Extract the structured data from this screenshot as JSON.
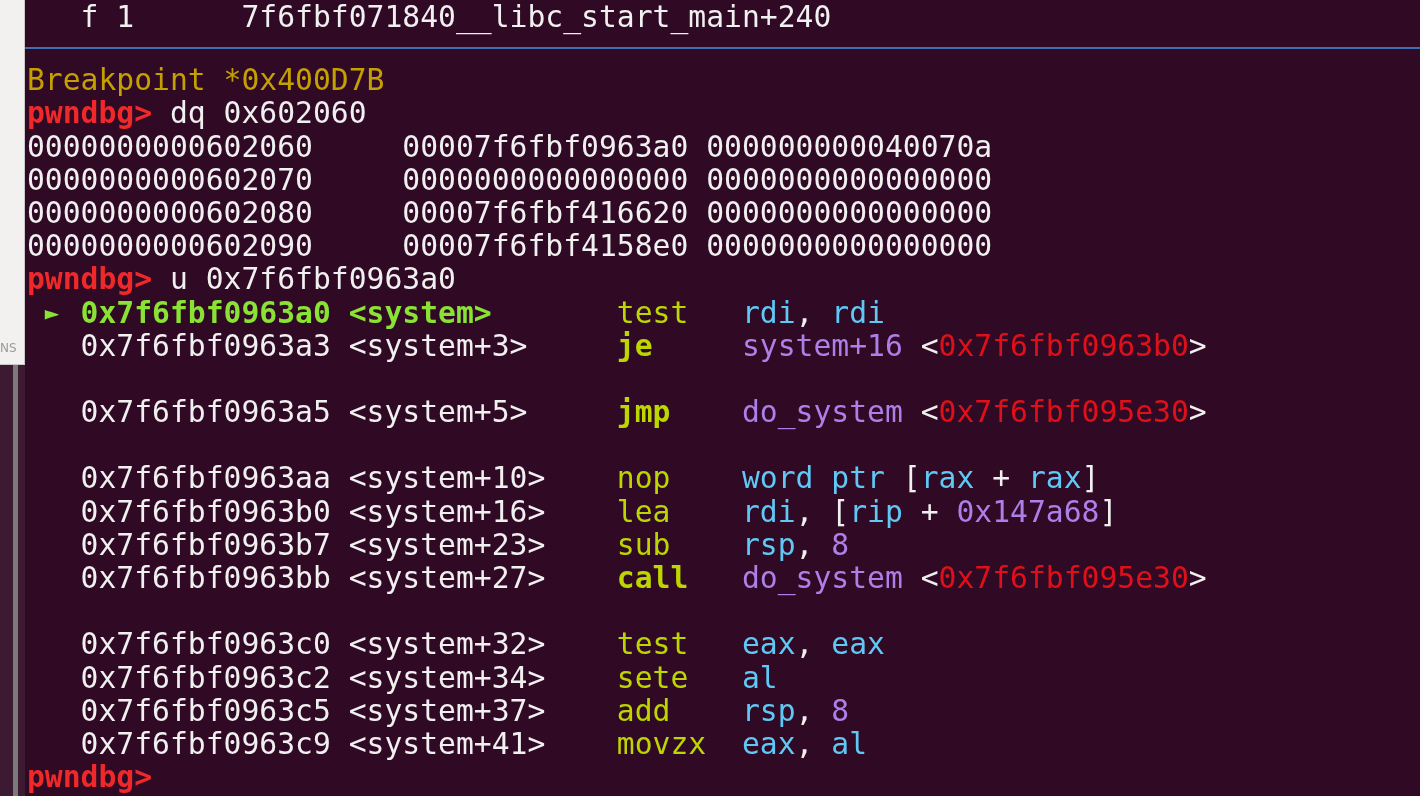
{
  "background_window": {
    "text": "NS"
  },
  "terminal": {
    "lines": [
      {
        "kind": "backtrace",
        "frame": "f 1",
        "address": "7f6fbf071840",
        "symbol": "__libc_start_main+240"
      },
      {
        "kind": "separator"
      },
      {
        "kind": "message",
        "text": "Breakpoint *0x400D7B"
      },
      {
        "kind": "prompt",
        "prompt": "pwndbg>",
        "command": "dq 0x602060"
      },
      {
        "kind": "memory",
        "address": "0000000000602060",
        "values": [
          "00007f6fbf0963a0",
          "000000000040070a"
        ]
      },
      {
        "kind": "memory",
        "address": "0000000000602070",
        "values": [
          "0000000000000000",
          "0000000000000000"
        ]
      },
      {
        "kind": "memory",
        "address": "0000000000602080",
        "values": [
          "00007f6fbf416620",
          "0000000000000000"
        ]
      },
      {
        "kind": "memory",
        "address": "0000000000602090",
        "values": [
          "00007f6fbf4158e0",
          "0000000000000000"
        ]
      },
      {
        "kind": "prompt",
        "prompt": "pwndbg>",
        "command": "u 0x7f6fbf0963a0"
      },
      {
        "kind": "disasm",
        "current": true,
        "marker": "►",
        "address": "0x7f6fbf0963a0",
        "symbol": "<system>",
        "mnemonic": "test",
        "branch": false,
        "operands": [
          {
            "text": "rdi",
            "kind": "register"
          },
          {
            "text": ", ",
            "kind": "plain"
          },
          {
            "text": "rdi",
            "kind": "register"
          }
        ]
      },
      {
        "kind": "disasm",
        "current": false,
        "address": "0x7f6fbf0963a3",
        "symbol": "<system+3>",
        "mnemonic": "je",
        "branch": true,
        "operands": [
          {
            "text": "system+16",
            "kind": "symbol"
          },
          {
            "text": " <",
            "kind": "plain"
          },
          {
            "text": "0x7f6fbf0963b0",
            "kind": "address"
          },
          {
            "text": ">",
            "kind": "plain"
          }
        ]
      },
      {
        "kind": "blank"
      },
      {
        "kind": "disasm",
        "current": false,
        "address": "0x7f6fbf0963a5",
        "symbol": "<system+5>",
        "mnemonic": "jmp",
        "branch": true,
        "operands": [
          {
            "text": "do_system",
            "kind": "symbol"
          },
          {
            "text": " <",
            "kind": "plain"
          },
          {
            "text": "0x7f6fbf095e30",
            "kind": "address"
          },
          {
            "text": ">",
            "kind": "plain"
          }
        ]
      },
      {
        "kind": "blank"
      },
      {
        "kind": "disasm",
        "current": false,
        "address": "0x7f6fbf0963aa",
        "symbol": "<system+10>",
        "mnemonic": "nop",
        "branch": false,
        "operands": [
          {
            "text": "word ptr",
            "kind": "register"
          },
          {
            "text": " [",
            "kind": "plain"
          },
          {
            "text": "rax",
            "kind": "register"
          },
          {
            "text": " + ",
            "kind": "plain"
          },
          {
            "text": "rax",
            "kind": "register"
          },
          {
            "text": "]",
            "kind": "plain"
          }
        ]
      },
      {
        "kind": "disasm",
        "current": false,
        "address": "0x7f6fbf0963b0",
        "symbol": "<system+16>",
        "mnemonic": "lea",
        "branch": false,
        "operands": [
          {
            "text": "rdi",
            "kind": "register"
          },
          {
            "text": ", [",
            "kind": "plain"
          },
          {
            "text": "rip",
            "kind": "register"
          },
          {
            "text": " + ",
            "kind": "plain"
          },
          {
            "text": "0x147a68",
            "kind": "symbol"
          },
          {
            "text": "]",
            "kind": "plain"
          }
        ]
      },
      {
        "kind": "disasm",
        "current": false,
        "address": "0x7f6fbf0963b7",
        "symbol": "<system+23>",
        "mnemonic": "sub",
        "branch": false,
        "operands": [
          {
            "text": "rsp",
            "kind": "register"
          },
          {
            "text": ", ",
            "kind": "plain"
          },
          {
            "text": "8",
            "kind": "symbol"
          }
        ]
      },
      {
        "kind": "disasm",
        "current": false,
        "address": "0x7f6fbf0963bb",
        "symbol": "<system+27>",
        "mnemonic": "call",
        "branch": true,
        "operands": [
          {
            "text": "do_system",
            "kind": "symbol"
          },
          {
            "text": " <",
            "kind": "plain"
          },
          {
            "text": "0x7f6fbf095e30",
            "kind": "address"
          },
          {
            "text": ">",
            "kind": "plain"
          }
        ]
      },
      {
        "kind": "blank"
      },
      {
        "kind": "disasm",
        "current": false,
        "address": "0x7f6fbf0963c0",
        "symbol": "<system+32>",
        "mnemonic": "test",
        "branch": false,
        "operands": [
          {
            "text": "eax",
            "kind": "register"
          },
          {
            "text": ", ",
            "kind": "plain"
          },
          {
            "text": "eax",
            "kind": "register"
          }
        ]
      },
      {
        "kind": "disasm",
        "current": false,
        "address": "0x7f6fbf0963c2",
        "symbol": "<system+34>",
        "mnemonic": "sete",
        "branch": false,
        "operands": [
          {
            "text": "al",
            "kind": "register"
          }
        ]
      },
      {
        "kind": "disasm",
        "current": false,
        "address": "0x7f6fbf0963c5",
        "symbol": "<system+37>",
        "mnemonic": "add",
        "branch": false,
        "operands": [
          {
            "text": "rsp",
            "kind": "register"
          },
          {
            "text": ", ",
            "kind": "plain"
          },
          {
            "text": "8",
            "kind": "symbol"
          }
        ]
      },
      {
        "kind": "disasm",
        "current": false,
        "address": "0x7f6fbf0963c9",
        "symbol": "<system+41>",
        "mnemonic": "movzx",
        "branch": false,
        "operands": [
          {
            "text": "eax",
            "kind": "register"
          },
          {
            "text": ", ",
            "kind": "plain"
          },
          {
            "text": "al",
            "kind": "register"
          }
        ]
      },
      {
        "kind": "prompt",
        "prompt": "pwndbg>"
      }
    ]
  }
}
